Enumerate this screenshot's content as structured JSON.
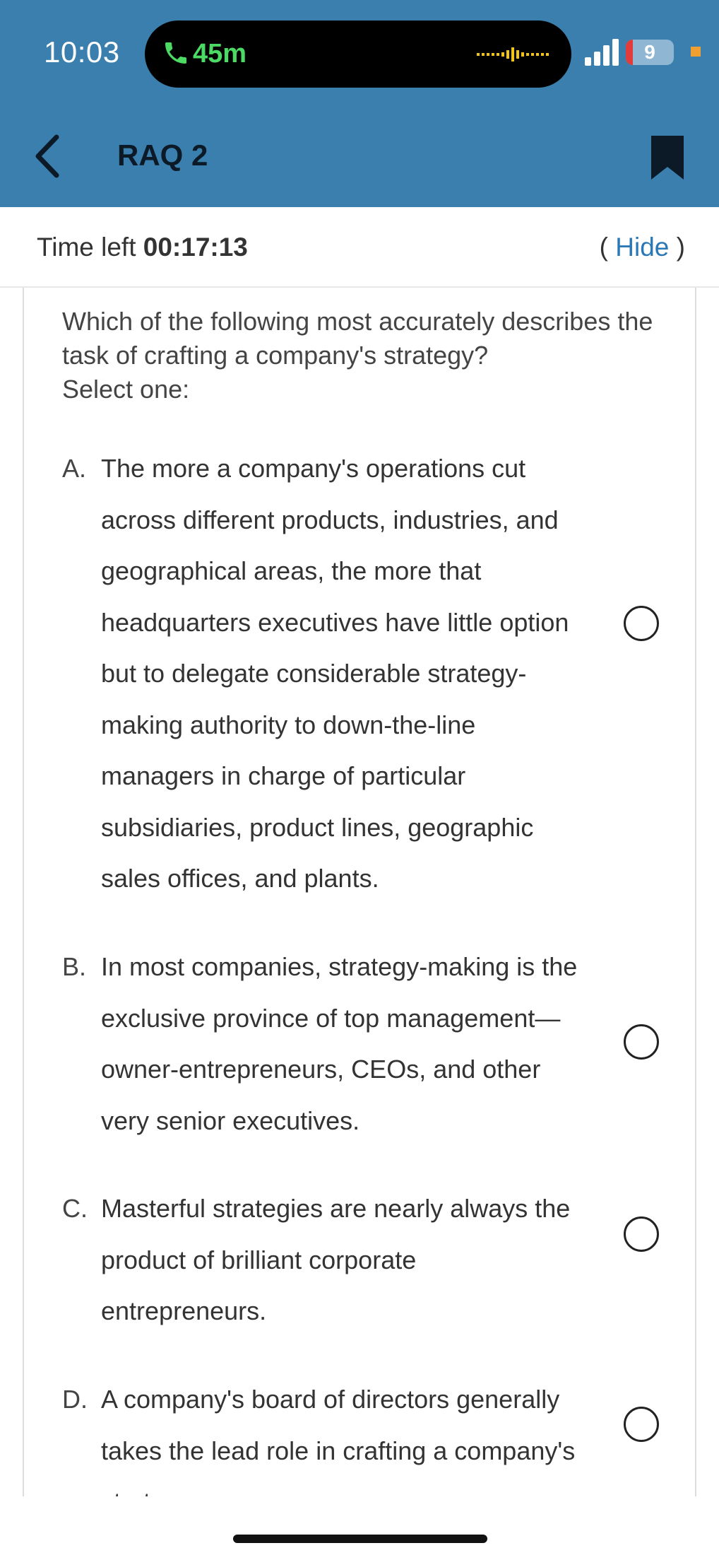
{
  "status_bar": {
    "time": "10:03",
    "call_duration": "45m",
    "battery_level": "9",
    "colors": {
      "call_green": "#4cd964",
      "battery_low": "#e23b3b"
    }
  },
  "nav": {
    "title": "RAQ 2",
    "background_color": "#3a7fad"
  },
  "timer": {
    "label": "Time left",
    "value": "00:17:13",
    "hide_open": "(",
    "hide_label": "Hide",
    "hide_close": ")"
  },
  "question": {
    "text": "Which of the following most accurately describes the task of crafting a company's strategy?",
    "instruction": "Select one:"
  },
  "options": [
    {
      "letter": "A.",
      "text": "The more a company's operations cut across different products, industries, and geographical areas, the more that headquarters executives have little option but to delegate considerable strategy-making authority to down-the-line managers in charge of particular subsidiaries, product lines, geographic sales offices, and plants.",
      "selected": false
    },
    {
      "letter": "B.",
      "text": "In most companies, strategy-making is the exclusive province of top management—owner-entrepreneurs, CEOs, and other very senior executives.",
      "selected": false
    },
    {
      "letter": "C.",
      "text": "Masterful strategies are nearly always the product of brilliant corporate entrepreneurs.",
      "selected": false
    },
    {
      "letter": "D.",
      "text": "A company's board of directors generally takes the lead role in crafting a company's strategy.",
      "selected": false
    }
  ]
}
